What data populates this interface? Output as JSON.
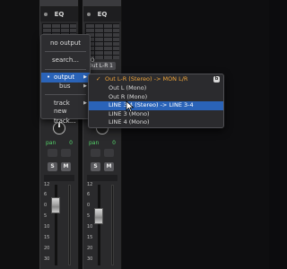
{
  "strips": [
    {
      "eq_label": "EQ",
      "pan_label": "pan",
      "pan_value": "0",
      "s": "S",
      "m": "M"
    },
    {
      "eq_label": "EQ",
      "pan_label": "pan",
      "pan_value": "0",
      "s": "S",
      "m": "M",
      "io_label": "I/O",
      "output_value": "Out L-R",
      "output_mark": "1"
    }
  ],
  "scale": [
    "12",
    "6",
    "0",
    "5",
    "10",
    "15",
    "20",
    "30"
  ],
  "context_menu": {
    "items": [
      {
        "label": "no output"
      },
      {
        "label": "search..."
      },
      {
        "label": "output",
        "bullet": "•",
        "arrow": "▶",
        "active": true
      },
      {
        "label": "bus",
        "arrow": "▶"
      },
      {
        "label": "track",
        "arrow": "▶"
      },
      {
        "label": "new track..."
      }
    ]
  },
  "output_submenu": {
    "items": [
      {
        "label": "Out L-R (Stereo) -> MON L/R",
        "selected": true,
        "check": "✓",
        "badge": "b"
      },
      {
        "label": "Out L (Mono)"
      },
      {
        "label": "Out R (Mono)"
      },
      {
        "label": "LINE 3-4 (Stereo) -> LINE 3-4",
        "hover": true
      },
      {
        "label": "LINE 3 (Mono)"
      },
      {
        "label": "LINE 4 (Mono)"
      }
    ]
  },
  "colors": {
    "accent_blue": "#2a63b8",
    "selected_orange": "#f0a53a",
    "pan_green": "#55d46b"
  }
}
